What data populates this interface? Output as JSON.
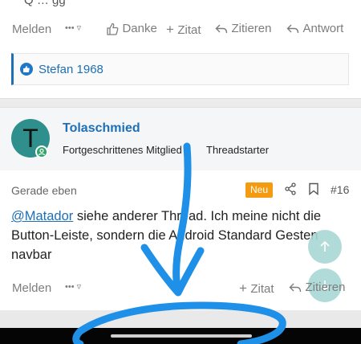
{
  "top_cut_text": "Q                             … gg",
  "actions1": {
    "report": "Melden",
    "more": "•••",
    "thanks": "Danke",
    "quote_add": "Zitat",
    "quote": "Zitieren",
    "reply": "Antwort"
  },
  "reactions": {
    "user": "Stefan 1968"
  },
  "post": {
    "avatar_letter": "T",
    "username": "Tolaschmied",
    "user_title": "Fortgeschrittenes Mitglied",
    "thread_starter": "Threadstarter",
    "time": "Gerade eben",
    "badge_new": "Neu",
    "number": "#16",
    "mention": "@Matador",
    "text": " siehe anderer Thread. Ich meine nicht die Button-Leiste, sondern die Android Standard Gesten navbar"
  },
  "actions2": {
    "report": "Melden",
    "more": "•••",
    "quote_add": "Zitat",
    "quote": "Zitieren"
  },
  "colors": {
    "link": "#1e6fb5",
    "badge_new": "#f39c12",
    "scribble": "#1e90e8",
    "fab": "#a8d8d4"
  }
}
